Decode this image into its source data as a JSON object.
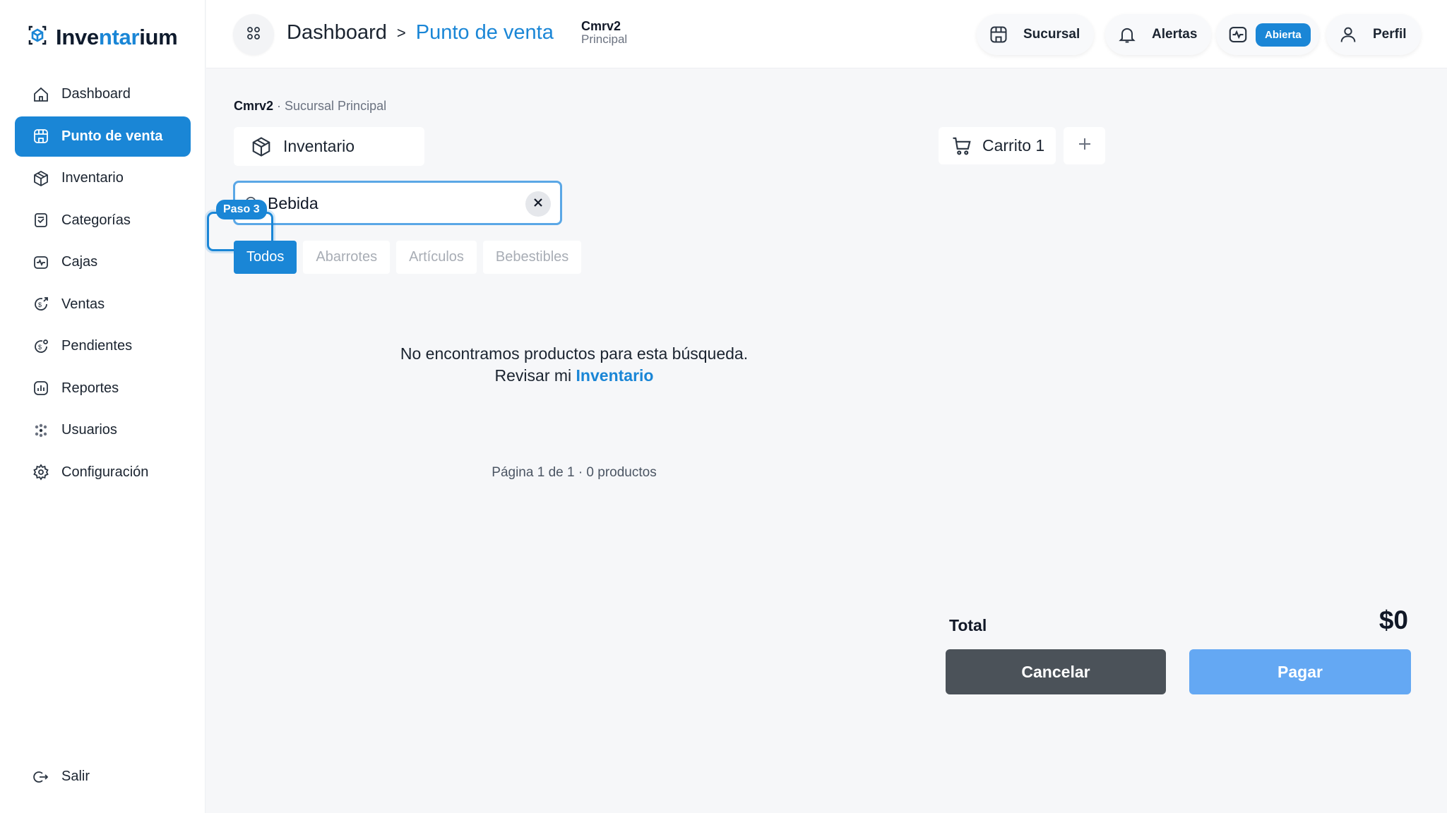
{
  "brand": {
    "name_part1": "Inve",
    "name_part2": "ntar",
    "name_part3": "ium"
  },
  "sidebar": {
    "items": [
      {
        "label": "Dashboard",
        "icon": "home-icon"
      },
      {
        "label": "Punto de venta",
        "icon": "store-icon",
        "active": true
      },
      {
        "label": "Inventario",
        "icon": "box-icon"
      },
      {
        "label": "Categorías",
        "icon": "tag-icon"
      },
      {
        "label": "Cajas",
        "icon": "cash-register-icon"
      },
      {
        "label": "Ventas",
        "icon": "sales-icon"
      },
      {
        "label": "Pendientes",
        "icon": "pending-icon"
      },
      {
        "label": "Reportes",
        "icon": "chart-icon"
      },
      {
        "label": "Usuarios",
        "icon": "users-icon"
      },
      {
        "label": "Configuración",
        "icon": "gear-icon"
      }
    ],
    "logout_label": "Salir"
  },
  "header": {
    "breadcrumb_root": "Dashboard",
    "breadcrumb_sep": ">",
    "breadcrumb_current": "Punto de venta",
    "company": "Cmrv2",
    "branch": "Principal",
    "sucursal_label": "Sucursal",
    "alertas_label": "Alertas",
    "caja_status": "Abierta",
    "perfil_label": "Perfil"
  },
  "main": {
    "company": "Cmrv2",
    "branch_text": " · Sucursal Principal",
    "inventory_tab": "Inventario",
    "search": {
      "value": "Bebida",
      "placeholder": ""
    },
    "tour_step": "Paso 3",
    "categories": [
      "Todos",
      "Abarrotes",
      "Artículos",
      "Bebestibles"
    ],
    "empty_message": "No encontramos productos para esta búsqueda.",
    "empty_prefix": "Revisar mi ",
    "empty_link": "Inventario",
    "pager": "Página 1 de 1 · 0 productos"
  },
  "cart": {
    "tab_label": "Carrito 1",
    "total_label": "Total",
    "total_value": "$0",
    "cancel_label": "Cancelar",
    "pay_label": "Pagar"
  },
  "colors": {
    "accent": "#1a86d6",
    "pay": "#64a8f3",
    "cancel": "#4b5259"
  }
}
